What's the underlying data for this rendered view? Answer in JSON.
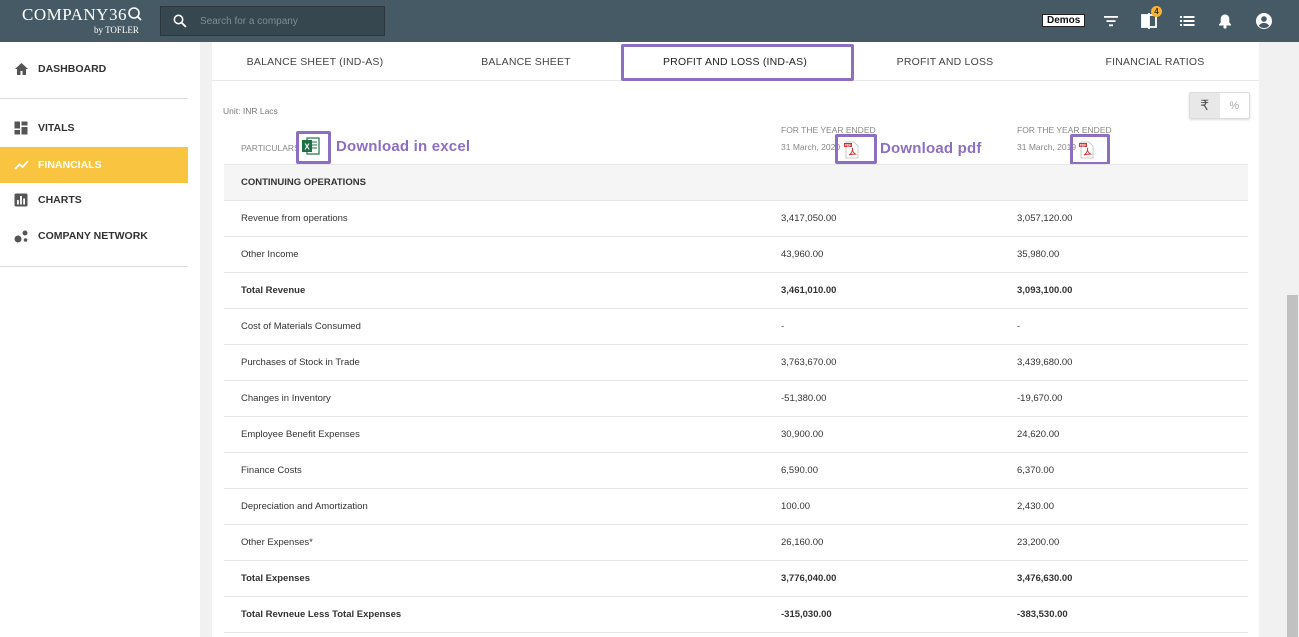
{
  "header": {
    "logo_main": "COMPANY36",
    "logo_sub": "by TOFLER",
    "search_placeholder": "Search for a company",
    "demos_label": "Demos",
    "notification_count": "4",
    "icons": [
      "filter-icon",
      "compare-icon",
      "list-icon",
      "bell-icon",
      "account-icon"
    ]
  },
  "sidebar": {
    "items": [
      {
        "label": "DASHBOARD",
        "icon": "home-icon"
      },
      {
        "label": "VITALS",
        "icon": "dashboard-grid-icon"
      },
      {
        "label": "FINANCIALS",
        "icon": "trend-line-icon",
        "active": true
      },
      {
        "label": "CHARTS",
        "icon": "bar-chart-icon"
      },
      {
        "label": "COMPANY NETWORK",
        "icon": "network-icon"
      }
    ],
    "accent_color": "#f9c440"
  },
  "tabs": [
    {
      "label": "BALANCE SHEET (IND-AS)"
    },
    {
      "label": "BALANCE SHEET"
    },
    {
      "label": "PROFIT AND LOSS (IND-AS)",
      "active": true
    },
    {
      "label": "PROFIT AND LOSS"
    },
    {
      "label": "FINANCIAL RATIOS"
    }
  ],
  "unit_label": "Unit: INR Lacs",
  "toggle": {
    "rupee": "₹",
    "percent": "%"
  },
  "table_header": {
    "particulars": "PARTICULARS",
    "col1_line1": "FOR THE YEAR ENDED",
    "col1_line2": "31 March, 2020",
    "col2_line1": "FOR THE YEAR ENDED",
    "col2_line2": "31 March, 2019"
  },
  "annotations": {
    "excel": "Download in excel",
    "pdf": "Download pdf",
    "highlight_color": "#8c6fc0"
  },
  "rows": [
    {
      "label": "CONTINUING OPERATIONS",
      "v1": "",
      "v2": "",
      "type": "section"
    },
    {
      "label": "Revenue from operations",
      "v1": "3,417,050.00",
      "v2": "3,057,120.00",
      "type": "normal"
    },
    {
      "label": "Other Income",
      "v1": "43,960.00",
      "v2": "35,980.00",
      "type": "normal"
    },
    {
      "label": "Total Revenue",
      "v1": "3,461,010.00",
      "v2": "3,093,100.00",
      "type": "bold"
    },
    {
      "label": "Cost of Materials Consumed",
      "v1": "-",
      "v2": "-",
      "type": "normal"
    },
    {
      "label": "Purchases of Stock in Trade",
      "v1": "3,763,670.00",
      "v2": "3,439,680.00",
      "type": "normal"
    },
    {
      "label": "Changes in Inventory",
      "v1": "-51,380.00",
      "v2": "-19,670.00",
      "type": "normal"
    },
    {
      "label": "Employee Benefit Expenses",
      "v1": "30,900.00",
      "v2": "24,620.00",
      "type": "normal"
    },
    {
      "label": "Finance Costs",
      "v1": "6,590.00",
      "v2": "6,370.00",
      "type": "normal"
    },
    {
      "label": "Depreciation and Amortization",
      "v1": "100.00",
      "v2": "2,430.00",
      "type": "normal"
    },
    {
      "label": "Other Expenses*",
      "v1": "26,160.00",
      "v2": "23,200.00",
      "type": "normal"
    },
    {
      "label": "Total Expenses",
      "v1": "3,776,040.00",
      "v2": "3,476,630.00",
      "type": "bold"
    },
    {
      "label": "Total Revneue Less Total Expenses",
      "v1": "-315,030.00",
      "v2": "-383,530.00",
      "type": "bold"
    }
  ]
}
